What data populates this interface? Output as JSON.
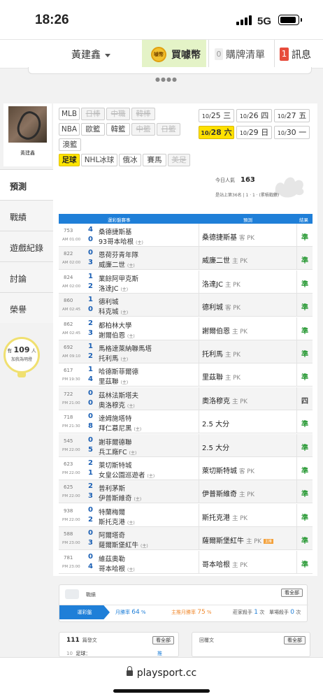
{
  "status_bar": {
    "time": "18:26",
    "network": "5G"
  },
  "top_nav": {
    "username": "黃建鑫",
    "buy_coins_label": "買噱幣",
    "coin_text": "噱幣",
    "cart_count": "0",
    "cart_label": "購牌清單",
    "message_count": "1",
    "message_label": "訊息"
  },
  "profile": {
    "name": "黃建鑫"
  },
  "side_menu": [
    {
      "label": "預測",
      "active": true
    },
    {
      "label": "戰績",
      "active": false
    },
    {
      "label": "遊戲紀錄",
      "active": false
    },
    {
      "label": "討論",
      "active": false
    },
    {
      "label": "榮譽",
      "active": false
    }
  ],
  "fans": {
    "prefix": "有",
    "count": "109",
    "suffix": "人",
    "caption": "加我為明燈"
  },
  "leagues": [
    {
      "label": "MLB",
      "state": "normal"
    },
    {
      "label": "日棒",
      "state": "off"
    },
    {
      "label": "中職",
      "state": "off"
    },
    {
      "label": "韓棒",
      "state": "off"
    },
    {
      "label": "NBA",
      "state": "normal"
    },
    {
      "label": "歐籃",
      "state": "normal"
    },
    {
      "label": "韓籃",
      "state": "normal"
    },
    {
      "label": "中籃",
      "state": "off"
    },
    {
      "label": "日籃",
      "state": "off"
    },
    {
      "label": "澳籃",
      "state": "normal"
    },
    {
      "label": "足球",
      "state": "selected"
    },
    {
      "label": "NHL冰球",
      "state": "normal"
    },
    {
      "label": "俄冰",
      "state": "normal"
    },
    {
      "label": "賽馬",
      "state": "normal"
    },
    {
      "label": "美足",
      "state": "off"
    }
  ],
  "dates": [
    {
      "day": "10/",
      "num": "25",
      "wd": "三",
      "selected": false
    },
    {
      "day": "10/",
      "num": "26",
      "wd": "四",
      "selected": false
    },
    {
      "day": "10/",
      "num": "27",
      "wd": "五",
      "selected": false
    },
    {
      "day": "10/",
      "num": "28",
      "wd": "六",
      "selected": true
    },
    {
      "day": "10/",
      "num": "29",
      "wd": "日",
      "selected": false
    },
    {
      "day": "10/",
      "num": "30",
      "wd": "一",
      "selected": false
    }
  ],
  "popularity": {
    "label": "今日人氣",
    "value": "163",
    "rank_text": "是站上第36名 | 1 · 1 · (累積戰績)"
  },
  "table": {
    "headers": {
      "match": "運彩盤賽事",
      "prediction": "預測",
      "result": "結果"
    },
    "rows": [
      {
        "no": "753",
        "time": "AM 01:00",
        "s1": "4",
        "s2": "0",
        "team1": "桑德捷斯基",
        "team2": "93哥本哈根",
        "host1": "",
        "host2": "(主)",
        "pick": "桑德捷斯基",
        "pick_side": "客 PK",
        "tag": "",
        "result": "準"
      },
      {
        "no": "822",
        "time": "AM 02:00",
        "s1": "0",
        "s2": "3",
        "team1": "恩荷芬青年隊",
        "team2": "威廉二世",
        "host1": "",
        "host2": "(主)",
        "pick": "威廉二世",
        "pick_side": "主 PK",
        "tag": "",
        "result": "準"
      },
      {
        "no": "824",
        "time": "AM 02:00",
        "s1": "1",
        "s2": "2",
        "team1": "業餘阿甲克斯",
        "team2": "洛達JC",
        "host1": "",
        "host2": "(主)",
        "pick": "洛達JC",
        "pick_side": "主 PK",
        "tag": "",
        "result": "準"
      },
      {
        "no": "860",
        "time": "AM 02:45",
        "s1": "1",
        "s2": "0",
        "team1": "德利城",
        "team2": "科克城",
        "host1": "",
        "host2": "(主)",
        "pick": "德利城",
        "pick_side": "客 PK",
        "tag": "",
        "result": "準"
      },
      {
        "no": "862",
        "time": "AM 02:45",
        "s1": "2",
        "s2": "3",
        "team1": "都柏林大學",
        "team2": "謝爾伯恩",
        "host1": "",
        "host2": "(主)",
        "pick": "謝爾伯恩",
        "pick_side": "主 PK",
        "tag": "",
        "result": "準"
      },
      {
        "no": "692",
        "time": "AM 09:10",
        "s1": "1",
        "s2": "2",
        "team1": "馬格達萊納聯馬塔",
        "team2": "托利馬",
        "host1": "",
        "host2": "(主)",
        "pick": "托利馬",
        "pick_side": "主 PK",
        "tag": "",
        "result": "準"
      },
      {
        "no": "617",
        "time": "PM 19:30",
        "s1": "1",
        "s2": "4",
        "team1": "哈德斯菲爾德",
        "team2": "里茲聯",
        "host1": "",
        "host2": "(主)",
        "pick": "里茲聯",
        "pick_side": "主 PK",
        "tag": "",
        "result": "準"
      },
      {
        "no": "722",
        "time": "PM 21:00",
        "s1": "0",
        "s2": "0",
        "team1": "茲林法斯塔夫",
        "team2": "奧洛穆克",
        "host1": "",
        "host2": "(主)",
        "pick": "奧洛穆克",
        "pick_side": "主 PK",
        "tag": "",
        "result": "四"
      },
      {
        "no": "718",
        "time": "PM 21:30",
        "s1": "0",
        "s2": "8",
        "team1": "達姆施塔特",
        "team2": "拜仁慕尼黑",
        "host1": "",
        "host2": "(主)",
        "pick": "2.5 大分",
        "pick_side": "",
        "tag": "",
        "result": "準"
      },
      {
        "no": "545",
        "time": "PM 22:00",
        "s1": "0",
        "s2": "5",
        "team1": "謝菲爾德聯",
        "team2": "兵工廠FC",
        "host1": "",
        "host2": "(主)",
        "pick": "2.5 大分",
        "pick_side": "",
        "tag": "",
        "result": "準"
      },
      {
        "no": "623",
        "time": "PM 22:00",
        "s1": "2",
        "s2": "1",
        "team1": "萊切斯特城",
        "team2": "女皇公園巡遊者",
        "host1": "",
        "host2": "(主)",
        "pick": "萊切斯特城",
        "pick_side": "客 PK",
        "tag": "",
        "result": "準"
      },
      {
        "no": "625",
        "time": "PM 22:00",
        "s1": "2",
        "s2": "3",
        "team1": "普利茅斯",
        "team2": "伊普斯維奇",
        "host1": "",
        "host2": "(主)",
        "pick": "伊普斯維奇",
        "pick_side": "主 PK",
        "tag": "",
        "result": "準"
      },
      {
        "no": "938",
        "time": "PM 22:00",
        "s1": "0",
        "s2": "2",
        "team1": "特蘭梅爾",
        "team2": "斯托克港",
        "host1": "",
        "host2": "(主)",
        "pick": "斯托克港",
        "pick_side": "主 PK",
        "tag": "",
        "result": "準"
      },
      {
        "no": "588",
        "time": "PM 23:00",
        "s1": "0",
        "s2": "3",
        "team1": "阿爾塔奇",
        "team2": "薩爾斯堡紅牛",
        "host1": "",
        "host2": "(主)",
        "pick": "薩爾斯堡紅牛",
        "pick_side": "主 PK",
        "tag": "主推",
        "result": "準"
      },
      {
        "no": "781",
        "time": "PM 23:00",
        "s1": "0",
        "s2": "4",
        "team1": "維茲奧勒",
        "team2": "哥本哈根",
        "host1": "",
        "host2": "(主)",
        "pick": "哥本哈根",
        "pick_side": "主 PK",
        "tag": "",
        "result": "準"
      }
    ]
  },
  "stats": {
    "title": "戰績",
    "more": "看全部",
    "tab": "運彩盤",
    "month_label": "月勝率",
    "month_value": "64",
    "pct": "%",
    "host_label": "主推月勝率",
    "host_value": "75",
    "streak_label": "莊家殺手",
    "streak_value": "1",
    "unit": "次",
    "single_label": "單場殺手",
    "single_value": "0"
  },
  "posts": {
    "count": "111",
    "label": "篇發文",
    "more": "看全部",
    "row_no": "10",
    "row_text": "足球：",
    "row_badge": "推",
    "row_badge_n": "2",
    "reply_label": "回覆文"
  },
  "browser": {
    "url": "playsport.cc"
  },
  "colors": {
    "accent": "#1f7fd8",
    "win": "#2a9a36",
    "selected": "#ffe500",
    "buy_bg": "#e4f3c7"
  }
}
